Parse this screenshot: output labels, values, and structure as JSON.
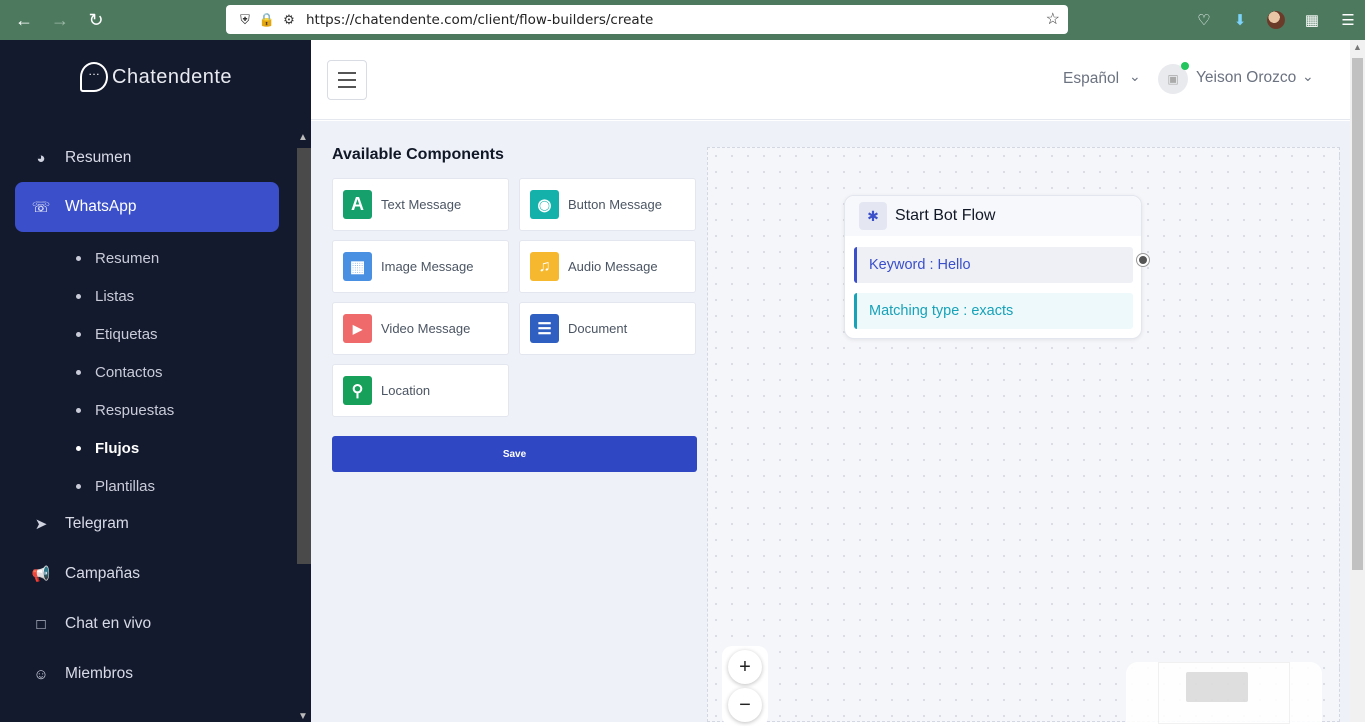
{
  "browser": {
    "url": "https://chatendente.com/client/flow-builders/create"
  },
  "sidebar": {
    "logo_text": "Chatendente",
    "items": [
      {
        "label": "Resumen",
        "icon": "dashboard-icon"
      },
      {
        "label": "WhatsApp",
        "icon": "whatsapp-icon",
        "active": true
      },
      {
        "label": "Telegram",
        "icon": "telegram-icon"
      },
      {
        "label": "Campañas",
        "icon": "megaphone-icon"
      },
      {
        "label": "Chat en vivo",
        "icon": "chat-icon"
      },
      {
        "label": "Miembros",
        "icon": "user-icon"
      }
    ],
    "subitems": [
      {
        "label": "Resumen"
      },
      {
        "label": "Listas"
      },
      {
        "label": "Etiquetas"
      },
      {
        "label": "Contactos"
      },
      {
        "label": "Respuestas"
      },
      {
        "label": "Flujos",
        "current": true
      },
      {
        "label": "Plantillas"
      }
    ]
  },
  "topbar": {
    "language": "Español",
    "user_name": "Yeison Orozco"
  },
  "components": {
    "title": "Available Components",
    "items": [
      {
        "label": "Text Message",
        "icon": "text-icon",
        "color": "#16a06b"
      },
      {
        "label": "Button Message",
        "icon": "button-message-icon",
        "color": "#14b1ab"
      },
      {
        "label": "Image Message",
        "icon": "image-icon",
        "color": "#4a90e2"
      },
      {
        "label": "Audio Message",
        "icon": "audio-icon",
        "color": "#f5b82e"
      },
      {
        "label": "Video Message",
        "icon": "video-icon",
        "color": "#ef6b6b"
      },
      {
        "label": "Document",
        "icon": "document-icon",
        "color": "#2f5fc0"
      },
      {
        "label": "Location",
        "icon": "location-icon",
        "color": "#16a05a"
      }
    ],
    "save_label": "Save"
  },
  "flow": {
    "node_title": "Start Bot Flow",
    "keyword_text": "Keyword : Hello",
    "matching_text": "Matching type : exacts"
  },
  "colors": {
    "accent": "#3a4fc9",
    "sidebar_bg": "#141a2e",
    "browser_bar": "#4d7a5f"
  }
}
